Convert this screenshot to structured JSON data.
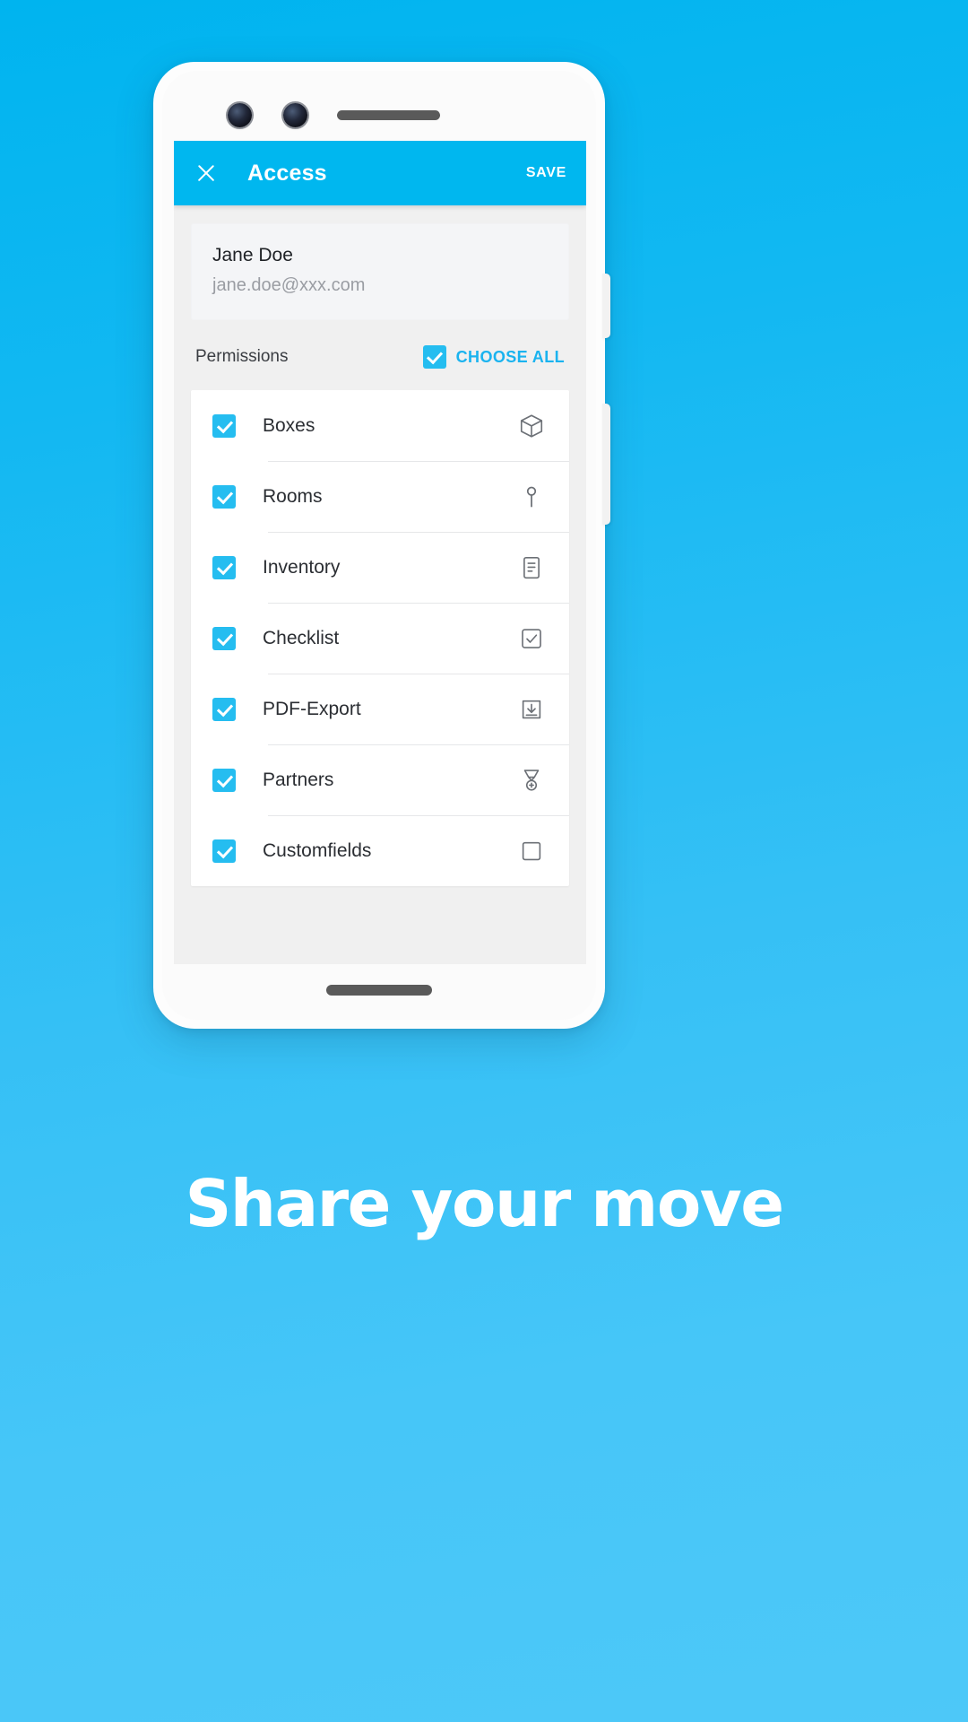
{
  "theme": {
    "background_gradient_from": "#00b4ef",
    "background_gradient_to": "#4dc8f8",
    "accent": "#00b7ef",
    "checkbox_blue": "#25bdf0",
    "link_blue": "#1ab3ef"
  },
  "appbar": {
    "close_icon": "close-icon",
    "title": "Access",
    "action_label": "SAVE"
  },
  "user": {
    "name": "Jane Doe",
    "email": "jane.doe@xxx.com"
  },
  "permissions": {
    "section_label": "Permissions",
    "choose_all_label": "CHOOSE ALL",
    "choose_all_checked": true,
    "items": [
      {
        "label": "Boxes",
        "checked": true,
        "icon": "box-3d-icon"
      },
      {
        "label": "Rooms",
        "checked": true,
        "icon": "map-pin-icon"
      },
      {
        "label": "Inventory",
        "checked": true,
        "icon": "document-list-icon"
      },
      {
        "label": "Checklist",
        "checked": true,
        "icon": "checkbox-square-icon"
      },
      {
        "label": "PDF-Export",
        "checked": true,
        "icon": "download-box-icon"
      },
      {
        "label": "Partners",
        "checked": true,
        "icon": "medal-icon"
      },
      {
        "label": "Customfields",
        "checked": true,
        "icon": "empty-square-icon"
      }
    ]
  },
  "marketing": {
    "headline": "Share your move"
  }
}
